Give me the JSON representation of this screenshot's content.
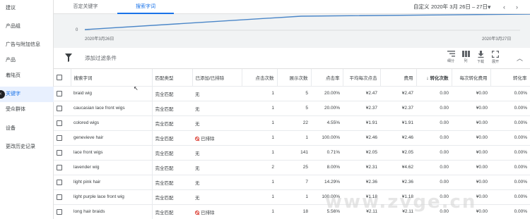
{
  "sidebar": {
    "items": [
      {
        "label": "建议"
      },
      {
        "label": "产品组"
      },
      {
        "label": "广告与附加信息"
      },
      {
        "label": "产品"
      },
      {
        "label": "着陆页"
      },
      {
        "label": "关键字"
      },
      {
        "label": "受众群体"
      },
      {
        "label": "设备"
      },
      {
        "label": "更改历史记录"
      }
    ],
    "active_index": 5
  },
  "topbar": {
    "tabs": [
      {
        "label": "否定关键字"
      },
      {
        "label": "搜索字词"
      }
    ],
    "date_prefix": "自定义",
    "date_range": "2020年 3月 26日 – 27日",
    "dropdown_icon": "▾",
    "prev_icon": "‹",
    "next_icon": "›"
  },
  "chart": {
    "y_zero_label": "0",
    "x_start_label": "2020年3月26日",
    "x_end_label": "2020年3月27日",
    "line_color": "#4a86c8"
  },
  "filter": {
    "placeholder": "添加过滤条件"
  },
  "tools": [
    {
      "label": "细分",
      "icon": "segment-icon"
    },
    {
      "label": "列",
      "icon": "columns-icon"
    },
    {
      "label": "下载",
      "icon": "download-icon"
    },
    {
      "label": "展开",
      "icon": "expand-icon"
    }
  ],
  "table": {
    "headers": [
      "搜索字词",
      "匹配类型",
      "已添加/已排除",
      "点击次数",
      "展示次数",
      "点击率",
      "平均每次点击",
      "费用",
      "转化次数",
      "每次转化费用",
      "转化率"
    ],
    "sort_arrow": "↓",
    "rows": [
      {
        "term": "braid wig",
        "match": "完全匹配",
        "status": "无",
        "excluded": false,
        "clicks": "1",
        "impr": "5",
        "ctr": "20.00%",
        "cpc": "¥2.47",
        "cost": "¥2.47",
        "conv": "0.00",
        "cpa": "¥0.00",
        "cr": "0.00%"
      },
      {
        "term": "caucasian lace front wigs",
        "match": "完全匹配",
        "status": "无",
        "excluded": false,
        "clicks": "1",
        "impr": "5",
        "ctr": "20.00%",
        "cpc": "¥2.37",
        "cost": "¥2.37",
        "conv": "0.00",
        "cpa": "¥0.00",
        "cr": "0.00%"
      },
      {
        "term": "colored wigs",
        "match": "完全匹配",
        "status": "无",
        "excluded": false,
        "clicks": "1",
        "impr": "22",
        "ctr": "4.55%",
        "cpc": "¥1.91",
        "cost": "¥1.91",
        "conv": "0.00",
        "cpa": "¥0.00",
        "cr": "0.00%"
      },
      {
        "term": "genevieve hair",
        "match": "完全匹配",
        "status": "已排除",
        "excluded": true,
        "clicks": "1",
        "impr": "1",
        "ctr": "100.00%",
        "cpc": "¥2.46",
        "cost": "¥2.46",
        "conv": "0.00",
        "cpa": "¥0.00",
        "cr": "0.00%"
      },
      {
        "term": "lace front wigs",
        "match": "完全匹配",
        "status": "无",
        "excluded": false,
        "clicks": "1",
        "impr": "141",
        "ctr": "0.71%",
        "cpc": "¥2.05",
        "cost": "¥2.05",
        "conv": "0.00",
        "cpa": "¥0.00",
        "cr": "0.00%"
      },
      {
        "term": "lavender wig",
        "match": "完全匹配",
        "status": "无",
        "excluded": false,
        "clicks": "2",
        "impr": "25",
        "ctr": "8.00%",
        "cpc": "¥2.31",
        "cost": "¥4.62",
        "conv": "0.00",
        "cpa": "¥0.00",
        "cr": "0.00%"
      },
      {
        "term": "light pink hair",
        "match": "完全匹配",
        "status": "无",
        "excluded": false,
        "clicks": "1",
        "impr": "7",
        "ctr": "14.29%",
        "cpc": "¥2.36",
        "cost": "¥2.36",
        "conv": "0.00",
        "cpa": "¥0.00",
        "cr": "0.00%"
      },
      {
        "term": "light purple lace front wig",
        "match": "完全匹配",
        "status": "无",
        "excluded": false,
        "clicks": "1",
        "impr": "1",
        "ctr": "100.00%",
        "cpc": "¥1.18",
        "cost": "¥1.18",
        "conv": "0.00",
        "cpa": "¥0.00",
        "cr": "0.00%"
      },
      {
        "term": "long hair braids",
        "match": "完全匹配",
        "status": "已排除",
        "excluded": true,
        "clicks": "1",
        "impr": "18",
        "ctr": "5.56%",
        "cpc": "¥2.11",
        "cost": "¥2.11",
        "conv": "0.00",
        "cpa": "¥0.00",
        "cr": "0.00%"
      }
    ]
  },
  "watermark": "www.zvge.cn"
}
